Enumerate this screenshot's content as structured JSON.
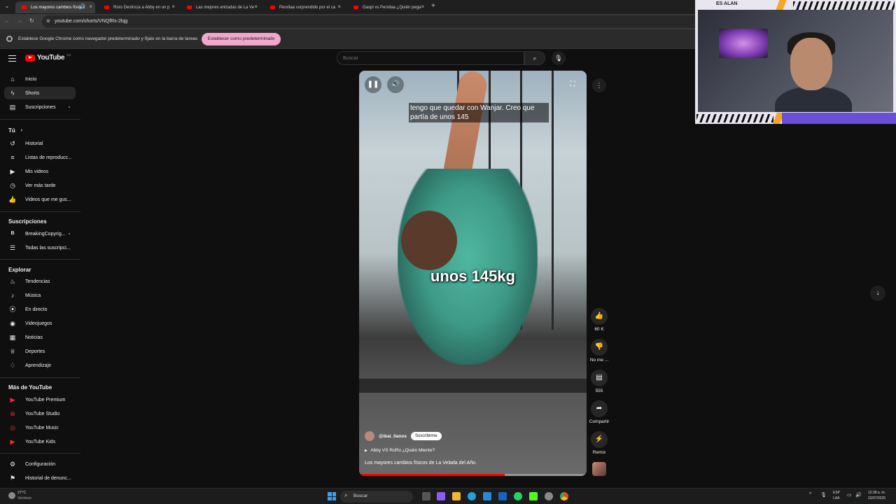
{
  "browser": {
    "tabs": [
      {
        "label": "Los mayores cambios físicos"
      },
      {
        "label": "Roro Destroza a Abby en un p"
      },
      {
        "label": "Las mejores entradas de La Ve"
      },
      {
        "label": "Perxitaa sorprendido por el ca"
      },
      {
        "label": "Gaspi vs Perxitaa ¿Quién pega"
      }
    ],
    "url": "youtube.com/shorts/VNQfRs-2lqg",
    "infobar_text": "Establece Google Chrome como navegador predeterminado y fíjalo en la barra de tareas",
    "infobar_button": "Establecer como predeterminado"
  },
  "header": {
    "logo": "YouTube",
    "logo_country": "CO",
    "search_placeholder": "Buscar"
  },
  "sidebar": {
    "main": [
      {
        "label": "Inicio",
        "icon": "home-icon"
      },
      {
        "label": "Shorts",
        "icon": "shorts-icon"
      },
      {
        "label": "Suscripciones",
        "icon": "subscriptions-icon"
      }
    ],
    "you_heading": "Tú",
    "you": [
      {
        "label": "Historial",
        "icon": "history-icon"
      },
      {
        "label": "Listas de reproducc...",
        "icon": "playlist-icon"
      },
      {
        "label": "Mis videos",
        "icon": "video-icon"
      },
      {
        "label": "Ver más tarde",
        "icon": "clock-icon"
      },
      {
        "label": "Videos que me gus...",
        "icon": "like-icon"
      }
    ],
    "subs_heading": "Suscripciones",
    "subs": [
      {
        "label": "BreakingCopyrig...",
        "icon": "channel-icon"
      },
      {
        "label": "Todas las suscripci...",
        "icon": "list-icon"
      }
    ],
    "explore_heading": "Explorar",
    "explore": [
      {
        "label": "Tendencias",
        "icon": "trending-icon"
      },
      {
        "label": "Música",
        "icon": "music-icon"
      },
      {
        "label": "En directo",
        "icon": "live-icon"
      },
      {
        "label": "Videojuegos",
        "icon": "gaming-icon"
      },
      {
        "label": "Noticias",
        "icon": "news-icon"
      },
      {
        "label": "Deportes",
        "icon": "trophy-icon"
      },
      {
        "label": "Aprendizaje",
        "icon": "bulb-icon"
      }
    ],
    "more_heading": "Más de YouTube",
    "more": [
      {
        "label": "YouTube Premium",
        "icon": "youtube-premium-icon"
      },
      {
        "label": "YouTube Studio",
        "icon": "youtube-studio-icon"
      },
      {
        "label": "YouTube Music",
        "icon": "youtube-music-icon"
      },
      {
        "label": "YouTube Kids",
        "icon": "youtube-kids-icon"
      }
    ],
    "settings": [
      {
        "label": "Configuración",
        "icon": "gear-icon"
      },
      {
        "label": "Historial de denunc...",
        "icon": "flag-icon"
      }
    ]
  },
  "short": {
    "caption": "tengo que quedar con Wanjar. Creo que partía de unos 145",
    "overlay_text": "unos 145kg",
    "channel": "@ibai_llanos",
    "subscribe_label": "Suscribirme",
    "playlist": "Abby VS RoRo ¿Quién Miente?",
    "title": "Los mayores cambios físicos de La Velada del Año.",
    "progress": 0.64
  },
  "actions": {
    "like_count": "60 K",
    "dislike_label": "No me ...",
    "comment_count": "555",
    "share_label": "Compartir",
    "remix_label": "Remix"
  },
  "taskbar": {
    "weather_temp": "27°C",
    "weather_desc": "Ventoso",
    "search_label": "Buscar",
    "lang_top": "ESP",
    "lang_bottom": "LAA",
    "time": "12:38 a. m.",
    "date": "22/07/2025"
  },
  "webcam": {
    "name": "ES ALAN"
  },
  "colors": {
    "brand_red": "#ff0000",
    "infobar_button": "#f0a7c9",
    "background": "#0f0f0f"
  }
}
